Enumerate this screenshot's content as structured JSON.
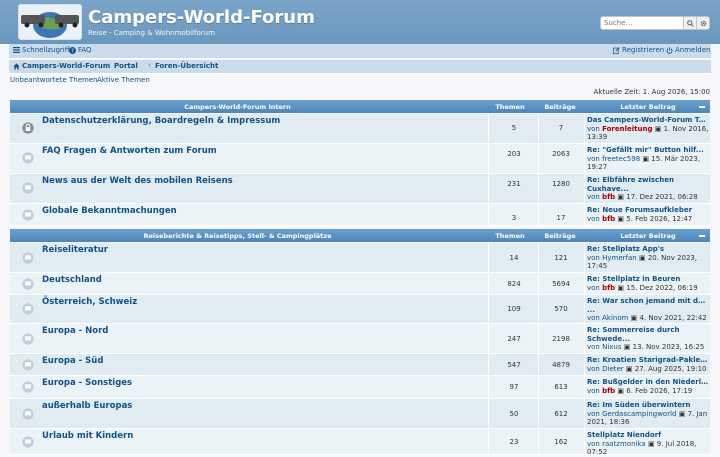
{
  "header": {
    "title": "Campers-World-Forum",
    "subtitle": "Reise - Camping & Wohnmobilforum",
    "search_placeholder": "Suche…"
  },
  "navbar": {
    "quick_links": "Schnellzugriff",
    "faq": "FAQ",
    "register": "Registrieren",
    "login": "Anmelden"
  },
  "breadcrumbs": [
    "Campers-World-Forum",
    "Portal",
    "Foren-Übersicht"
  ],
  "quick": {
    "unanswered": "Unbeantwortete Themen",
    "active": "Aktive Themen"
  },
  "current_time": "Aktuelle Zeit: 1. Aug 2026, 15:00",
  "colors": {
    "header": "#6a97bd",
    "link": "#105289",
    "row": "#e1ebf2",
    "row_alt": "#ecf3f7",
    "mod": "#aa0000"
  },
  "sections": [
    {
      "title": "Campers-World-Forum Intern",
      "col_topics": "Themen",
      "col_posts": "Beiträge",
      "col_last": "Letzter Beitrag",
      "forums": [
        {
          "name": "Datenschutzerklärung, Boardregeln & Impressum",
          "topics": "5",
          "posts": "7",
          "icon": "lock-icon",
          "last_title": "Das Campers-World-Forum Team",
          "by": "von",
          "author": "Forenleitung",
          "author_red": true,
          "date": "1. Nov 2016,",
          "date2": "13:39"
        },
        {
          "name": "FAQ Fragen & Antworten zum Forum",
          "topics": "203",
          "posts": "2063",
          "icon": "forum-icon",
          "last_title": "Re: \"Gefällt mir\" Button hilf...",
          "by": "von",
          "author": "freetec598",
          "author_red": false,
          "date": "15. Mär 2023,",
          "date2": "19:27"
        },
        {
          "name": "News aus der Welt des mobilen Reisens",
          "topics": "231",
          "posts": "1280",
          "icon": "forum-icon",
          "last_title": "Re: Elbfähre zwischen",
          "last_title2": "Cuxhave...",
          "by": "von",
          "author": "bfb",
          "author_red": true,
          "date": "17. Dez 2021, 06:28"
        },
        {
          "name": "Globale Bekanntmachungen",
          "topics": "3",
          "posts": "17",
          "icon": "forum-icon",
          "last_title": "Re: Neue Forumsaufkleber",
          "by": "von",
          "author": "bfb",
          "author_red": true,
          "date": "5. Feb 2026, 12:47"
        }
      ]
    },
    {
      "title": "Reiseberichte & Reisetipps, Stell- & Campingplätze",
      "col_topics": "Themen",
      "col_posts": "Beiträge",
      "col_last": "Letzter Beitrag",
      "forums": [
        {
          "name": "Reiseliteratur",
          "topics": "14",
          "posts": "121",
          "icon": "forum-icon",
          "last_title": "Re: Stellplatz App's",
          "by": "von",
          "author": "Hymerfan",
          "author_red": false,
          "date": "20. Nov 2023,",
          "date2": "17:45"
        },
        {
          "name": "Deutschland",
          "topics": "824",
          "posts": "5694",
          "icon": "forum-icon",
          "last_title": "Re: Stellplatz in Beuren",
          "by": "von",
          "author": "bfb",
          "author_red": true,
          "date": "15. Dez 2022, 06:19"
        },
        {
          "name": "Österreich, Schweiz",
          "topics": "109",
          "posts": "570",
          "icon": "forum-icon",
          "last_title": "Re: War schon jemand mit dem",
          "last_title2": "...",
          "by": "von",
          "author": "Akinom",
          "author_red": false,
          "date": "4. Nov 2021, 22:42"
        },
        {
          "name": "Europa - Nord",
          "topics": "247",
          "posts": "2198",
          "icon": "forum-icon",
          "last_title": "Re: Sommerreise durch",
          "last_title2": "Schwede...",
          "by": "von",
          "author": "Nixus",
          "author_red": false,
          "date": "13. Nov 2023, 16:25"
        },
        {
          "name": "Europa - Süd",
          "topics": "547",
          "posts": "4879",
          "icon": "forum-icon",
          "last_title": "Re: Kroatien Starigrad-Paklen...",
          "by": "von",
          "author": "Dieter",
          "author_red": false,
          "date": "27. Aug 2025, 19:10"
        },
        {
          "name": "Europa - Sonstiges",
          "topics": "97",
          "posts": "613",
          "icon": "forum-icon",
          "last_title": "Re: Bußgelder in den Niederla...",
          "by": "von",
          "author": "bfb",
          "author_red": true,
          "date": "6. Feb 2026, 17:19"
        },
        {
          "name": "außerhalb Europas",
          "topics": "50",
          "posts": "612",
          "icon": "forum-icon",
          "last_title": "Re: Im Süden überwintern",
          "by": "von",
          "author": "Gerdascampingworld",
          "author_red": false,
          "date": "7. Jan",
          "date2": "2021, 18:36"
        },
        {
          "name": "Urlaub mit Kindern",
          "topics": "23",
          "posts": "162",
          "icon": "forum-icon",
          "last_title": "Stellplatz Niendorf",
          "by": "von",
          "author": "raatzmonika",
          "author_red": false,
          "date": "9. Jul 2018,",
          "date2": "07:52"
        }
      ]
    }
  ]
}
